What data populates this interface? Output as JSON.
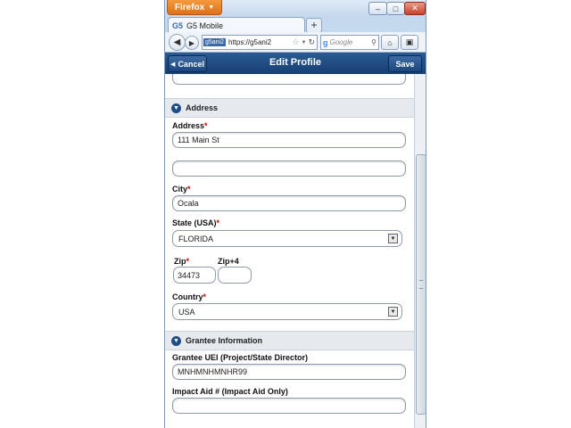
{
  "browser": {
    "menu_button": "Firefox",
    "tab_title": "G5 Mobile",
    "tab_favicon": "G5",
    "new_tab": "+",
    "url_site_badge": "g5ani2",
    "url": "https://g5ani2",
    "search_placeholder": "Google",
    "back_icon": "back-arrow",
    "forward_icon": "forward-arrow"
  },
  "header": {
    "cancel_label": "Cancel",
    "title": "Edit Profile",
    "save_label": "Save"
  },
  "sections": {
    "address": "Address",
    "grantee": "Grantee Information"
  },
  "form": {
    "address_label": "Address",
    "address_line1": "111 Main St",
    "address_line2": "",
    "city_label": "City",
    "city": "Ocala",
    "state_label": "State (USA)",
    "state": "FLORIDA",
    "zip_label": "Zip",
    "zip": "34473",
    "zip4_label": "Zip+4",
    "zip4": "",
    "country_label": "Country",
    "country": "USA",
    "uei_label": "Grantee UEI (Project/State Director)",
    "uei": "MNHMNHMNHR99",
    "impact_label": "Impact Aid # (Impact Aid Only)",
    "impact": ""
  },
  "colors": {
    "header_blue": "#1c477d",
    "required": "#cc0000"
  }
}
